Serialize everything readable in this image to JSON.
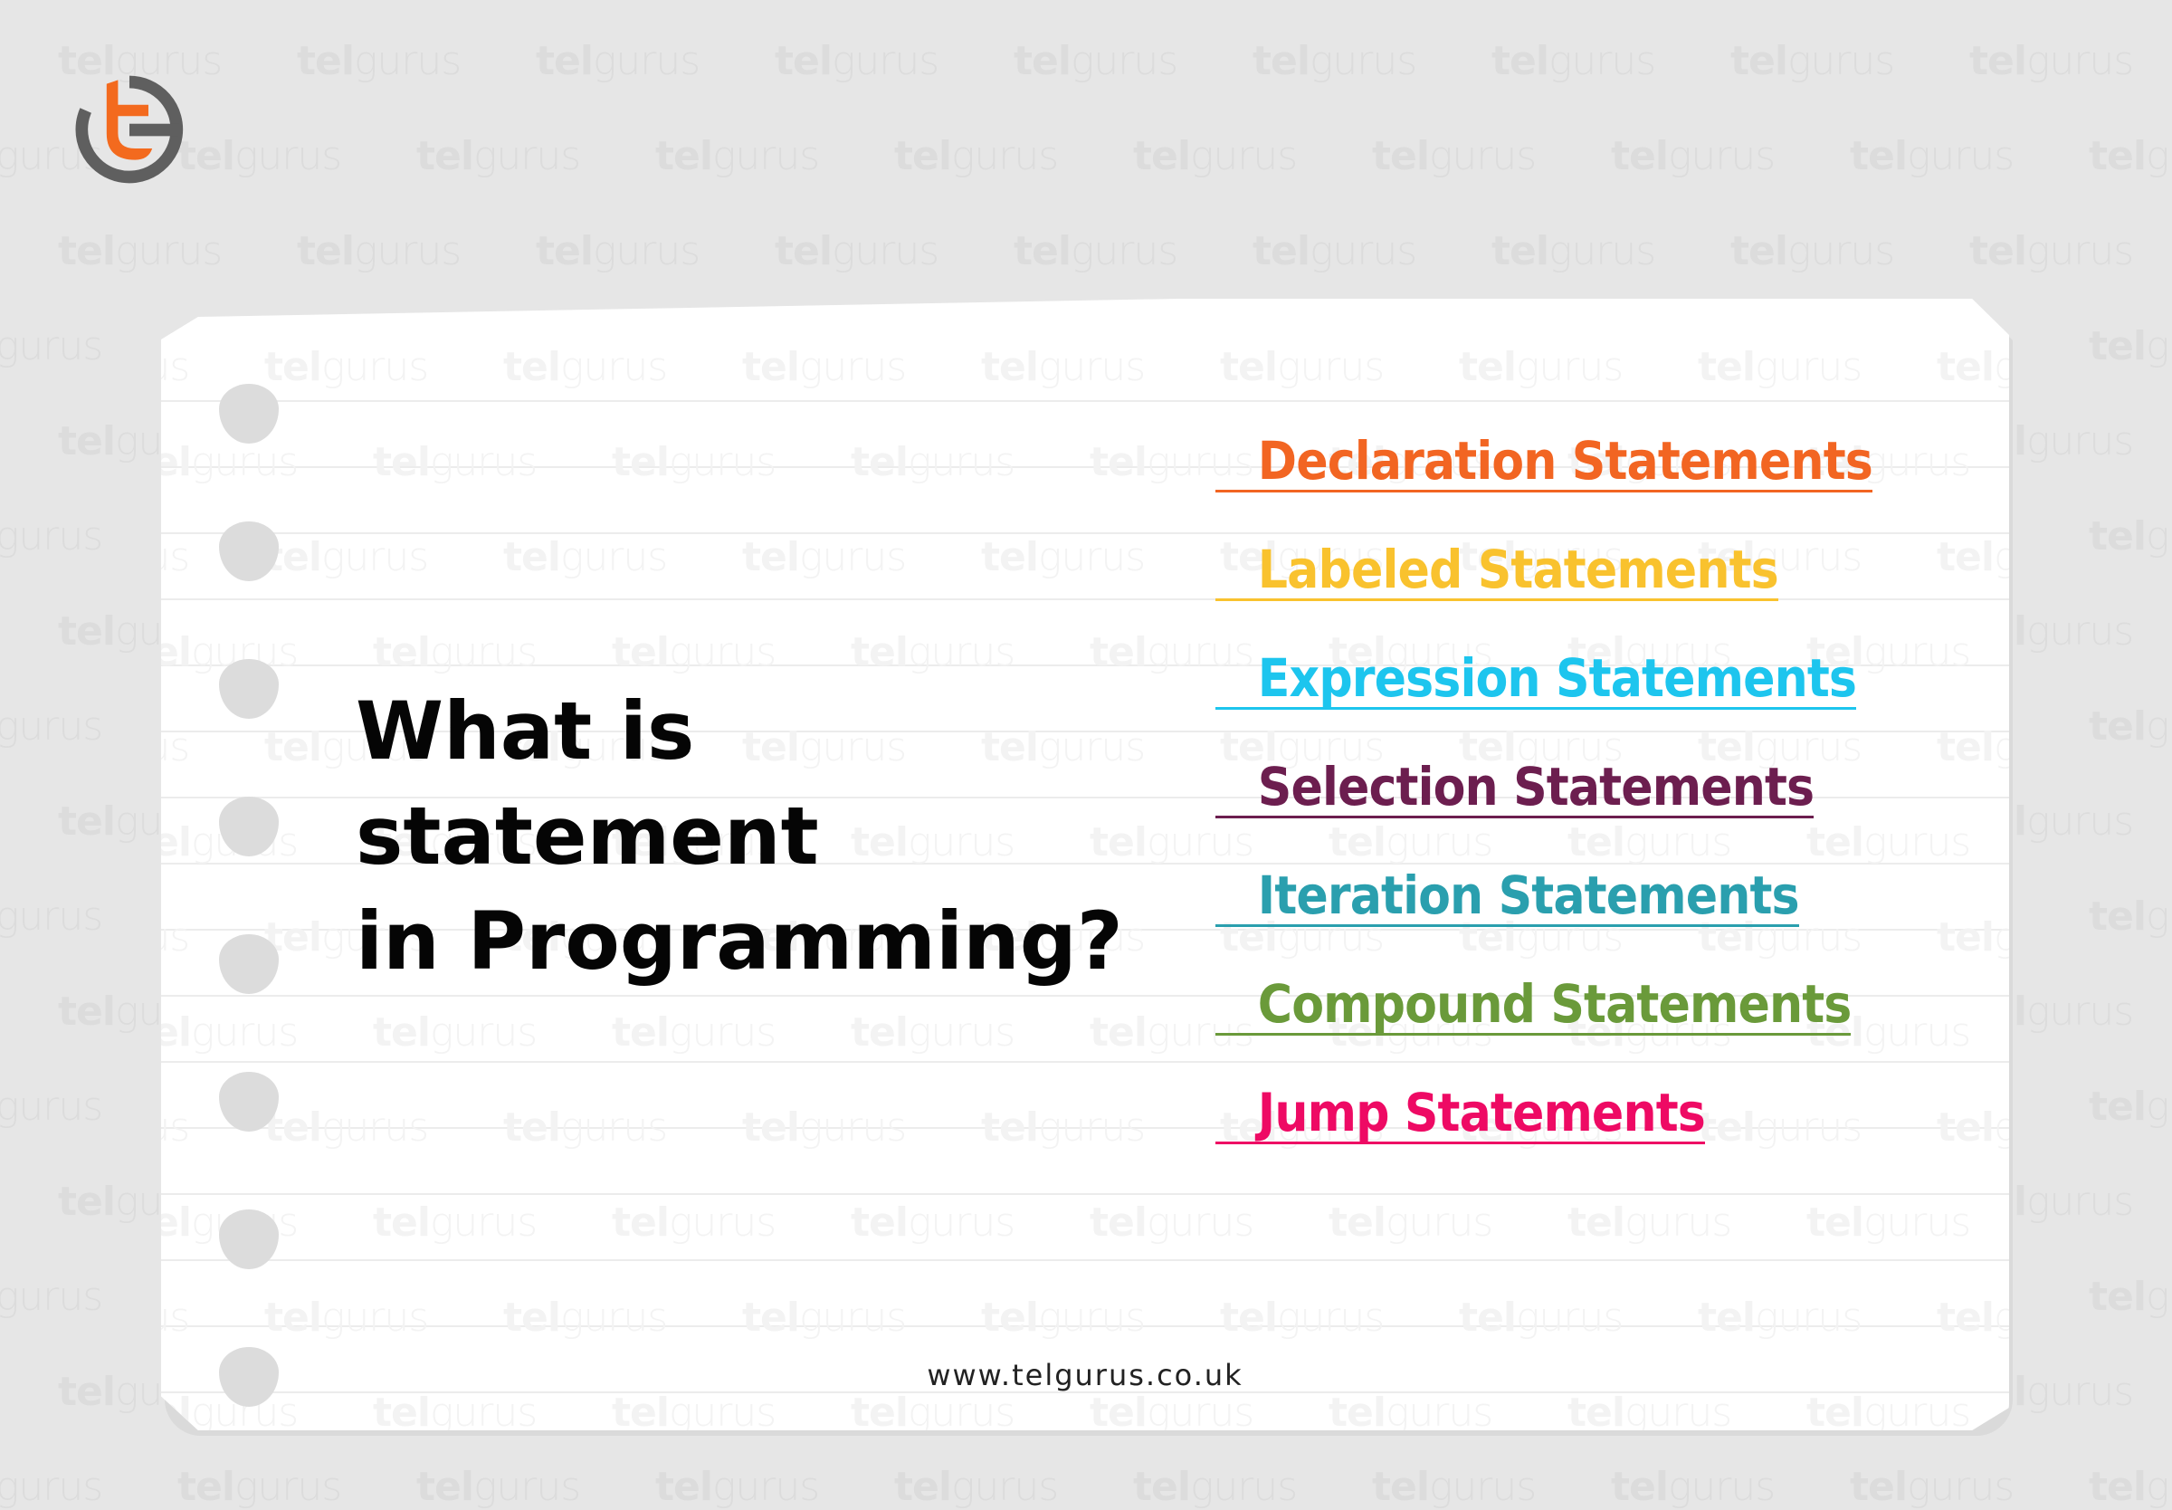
{
  "brand": {
    "logo_icon": "telgurus-tg-monogram-icon",
    "watermark_text_bold": "tel",
    "watermark_text_light": "gurus",
    "colors": {
      "background": "#e6e6e6",
      "logo_orange": "#f36a1e",
      "logo_gray": "#5f5f5f",
      "paper": "#ffffff",
      "ring_hole": "#dcdcdc"
    }
  },
  "heading": {
    "line1": "What is statement",
    "line2": "in Programming?"
  },
  "statements": [
    {
      "label": "Declaration Statements",
      "color": "#f26522"
    },
    {
      "label": "Labeled Statements",
      "color": "#f9c22e"
    },
    {
      "label": "Expression Statements",
      "color": "#1dc5ee"
    },
    {
      "label": "Selection Statements",
      "color": "#6c1e4f"
    },
    {
      "label": "Iteration Statements",
      "color": "#2a9fae"
    },
    {
      "label": "Compound Statements",
      "color": "#6a9a3a"
    },
    {
      "label": "Jump Statements",
      "color": "#ee0a64"
    }
  ],
  "footer": {
    "url": "www.telgurus.co.uk"
  }
}
